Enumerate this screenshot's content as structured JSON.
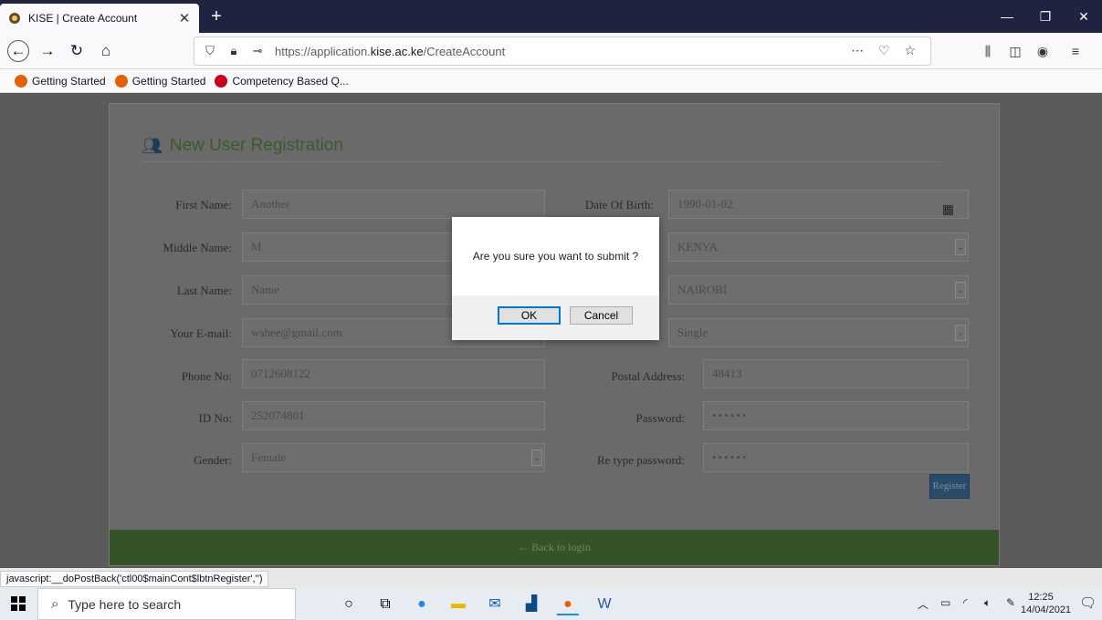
{
  "browser": {
    "tab_title": "KISE | Create Account",
    "url_prefix": "https://application.",
    "url_domain": "kise.ac.ke",
    "url_path": "/CreateAccount",
    "bookmarks": [
      {
        "label": "Getting Started",
        "color": "#e66000"
      },
      {
        "label": "Getting Started",
        "color": "#e66000"
      },
      {
        "label": "Competency Based Q...",
        "color": "#c7001b"
      }
    ]
  },
  "form": {
    "heading": "New User Registration",
    "first_name_label": "First Name:",
    "first_name_value": "Another",
    "middle_name_label": "Middle Name:",
    "middle_name_value": "M",
    "last_name_label": "Last Name:",
    "last_name_value": "Name",
    "email_label": "Your E-mail:",
    "email_value": "wshee@gmail.com",
    "phone_label": "Phone No:",
    "phone_value": "0712608122",
    "id_label": "ID No:",
    "id_value": "252074801",
    "gender_label": "Gender:",
    "gender_value": "Female",
    "dob_label": "Date Of Birth:",
    "dob_value": "1990-01-02",
    "country_value": "KENYA",
    "county_value": "NAIROBI",
    "marital_value": "Single",
    "postal_label": "Postal Address:",
    "postal_value": "48413",
    "password_label": "Password:",
    "password_value": "••••••",
    "retype_label": "Re type password:",
    "retype_value": "••••••",
    "register_label": "Register",
    "back_label": "← Back to login"
  },
  "dialog": {
    "message": "Are you sure you want to submit ?",
    "ok_label": "OK",
    "cancel_label": "Cancel"
  },
  "status_text": "javascript:__doPostBack('ctl00$mainCont$lbtnRegister','')",
  "taskbar": {
    "search_placeholder": "Type here to search",
    "time": "12:25",
    "date": "14/04/2021"
  }
}
